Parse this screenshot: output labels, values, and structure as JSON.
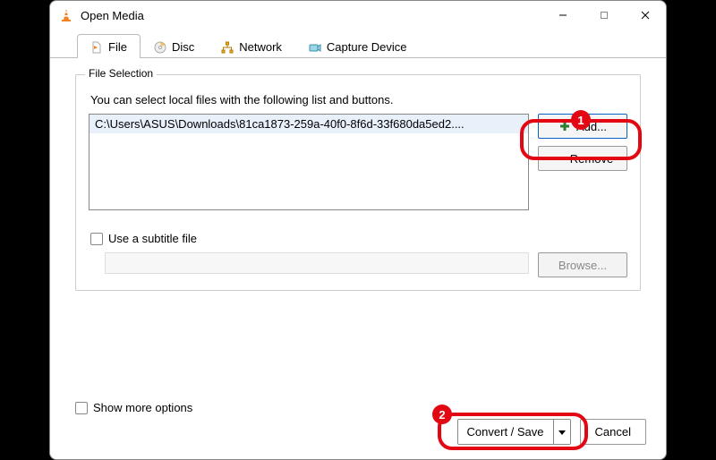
{
  "window": {
    "title": "Open Media"
  },
  "tabs": {
    "file": {
      "label": "File"
    },
    "disc": {
      "label": "Disc"
    },
    "network": {
      "label": "Network"
    },
    "capture": {
      "label": "Capture Device"
    }
  },
  "fileSelection": {
    "legend": "File Selection",
    "hint": "You can select local files with the following list and buttons.",
    "items": [
      "C:\\Users\\ASUS\\Downloads\\81ca1873-259a-40f0-8f6d-33f680da5ed2...."
    ],
    "add_label": "Add...",
    "remove_label": "Remove"
  },
  "subtitle": {
    "checkbox_label": "Use a subtitle file",
    "browse_label": "Browse..."
  },
  "moreOptions": {
    "label": "Show more options"
  },
  "footer": {
    "convert_label": "Convert / Save",
    "cancel_label": "Cancel"
  },
  "annotations": {
    "badge1": "1",
    "badge2": "2"
  }
}
